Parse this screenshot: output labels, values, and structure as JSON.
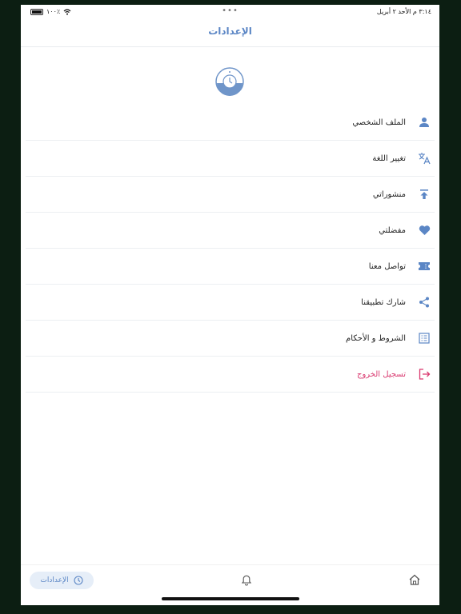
{
  "status_bar": {
    "time_date": "٣:١٤ م   الأحد ٢ أبريل",
    "battery_text": "١٠٠٪",
    "dots": "•••"
  },
  "header": {
    "title": "الإعدادات"
  },
  "menu": {
    "items": [
      {
        "label": "الملف الشخصي",
        "icon": "person-icon"
      },
      {
        "label": "تغيير اللغة",
        "icon": "translate-icon"
      },
      {
        "label": "منشوراتي",
        "icon": "upload-icon"
      },
      {
        "label": "مفضلتي",
        "icon": "heart-icon"
      },
      {
        "label": "تواصل معنا",
        "icon": "ticket-icon"
      },
      {
        "label": "شارك تطبيقنا",
        "icon": "share-icon"
      },
      {
        "label": "الشروط و الأحكام",
        "icon": "document-list-icon"
      },
      {
        "label": "تسجيل الخروج",
        "icon": "logout-icon"
      }
    ]
  },
  "bottom_nav": {
    "settings_label": "الإعدادات"
  },
  "colors": {
    "accent": "#5b86c5",
    "logout": "#d9376e"
  }
}
